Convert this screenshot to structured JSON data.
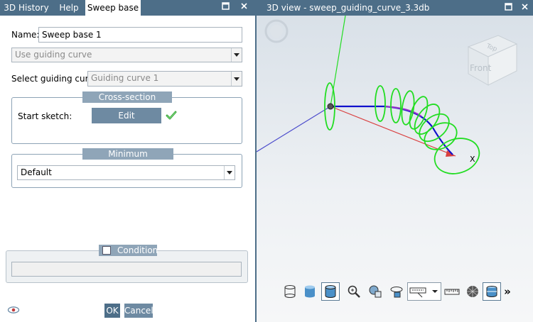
{
  "left_panel": {
    "tabs": [
      {
        "label": "3D History"
      },
      {
        "label": "Help"
      },
      {
        "label": "Sweep base"
      }
    ],
    "name_label": "Name:",
    "name_value": "Sweep base 1",
    "mode_select": "Use guiding curve",
    "guiding_curve_label": "Select guiding curve:",
    "guiding_curve_value": "Guiding curve 1",
    "cross_section": {
      "title": "Cross-section sketches",
      "start_sketch_label": "Start sketch:",
      "edit_label": "Edit"
    },
    "rasterization": {
      "title": "Minimum rasterization:",
      "value": "Default"
    },
    "condition": {
      "title": "Condition"
    },
    "ok_label": "OK",
    "cancel_label": "Cancel"
  },
  "right_panel": {
    "title": "3D view - sweep_guiding_curve_3.3db",
    "viewcube": {
      "top": "Top",
      "front": "Front"
    },
    "axis_label": "X",
    "more_label": "»"
  },
  "colors": {
    "header": "#4d6e88",
    "group_title": "#8fa5b8",
    "button": "#6e8aa2",
    "ring_green": "#22dd22",
    "curve_blue": "#1010cc",
    "axis_red": "#d94040"
  }
}
